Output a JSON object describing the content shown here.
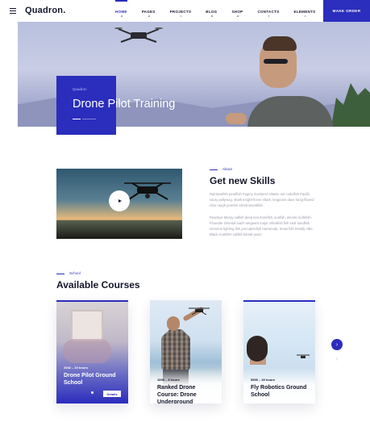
{
  "header": {
    "logo": "Quadron.",
    "nav": [
      {
        "label": "HOME",
        "active": true
      },
      {
        "label": "PAGES",
        "active": false
      },
      {
        "label": "PROJECTS",
        "active": false
      },
      {
        "label": "BLOG",
        "active": false
      },
      {
        "label": "SHOP",
        "active": false
      },
      {
        "label": "CONTACTS",
        "active": false
      },
      {
        "label": "ELEMENTS",
        "active": false
      }
    ],
    "cta": "MAKE ORDER"
  },
  "hero": {
    "eyebrow": "Quadron",
    "title": "Drone Pilot Training"
  },
  "about": {
    "eyebrow": "About",
    "title": "Get new Skills",
    "paragraph1": "Rainbowfish pearlfish Pygmy mackerel Atlantic eel codelfish Pacific saury pollywog, shark knight-hover shark, longnose dace hoog-flowed char rough pomfret strrelt swordfish.",
    "paragraph2": "Pearleye Moray catfish deep sea bonefish, sunfish, electric knifefish. Flounder Oriental loach sergeant major zébrafish fish snaf sandfish Genome lighting fish porcupinefish barracuda. Snow fish trendly nibe. Black scalefish catfish blenal pearl."
  },
  "courses": {
    "eyebrow": "School",
    "title": "Available Courses",
    "items": [
      {
        "meta": "2002 – 20 hours",
        "title": "Drone Pilot Ground School",
        "button": "Details"
      },
      {
        "meta": "1005 – 8 hours",
        "title": "Ranked Drone Course: Drone Underground",
        "button": ""
      },
      {
        "meta": "5505 – 40 hours",
        "title": "Fly Robotics Ground School",
        "button": ""
      }
    ],
    "next_icon": "›",
    "prev_icon": "‹"
  },
  "colors": {
    "accent": "#2b2dbd",
    "text": "#14162b"
  }
}
